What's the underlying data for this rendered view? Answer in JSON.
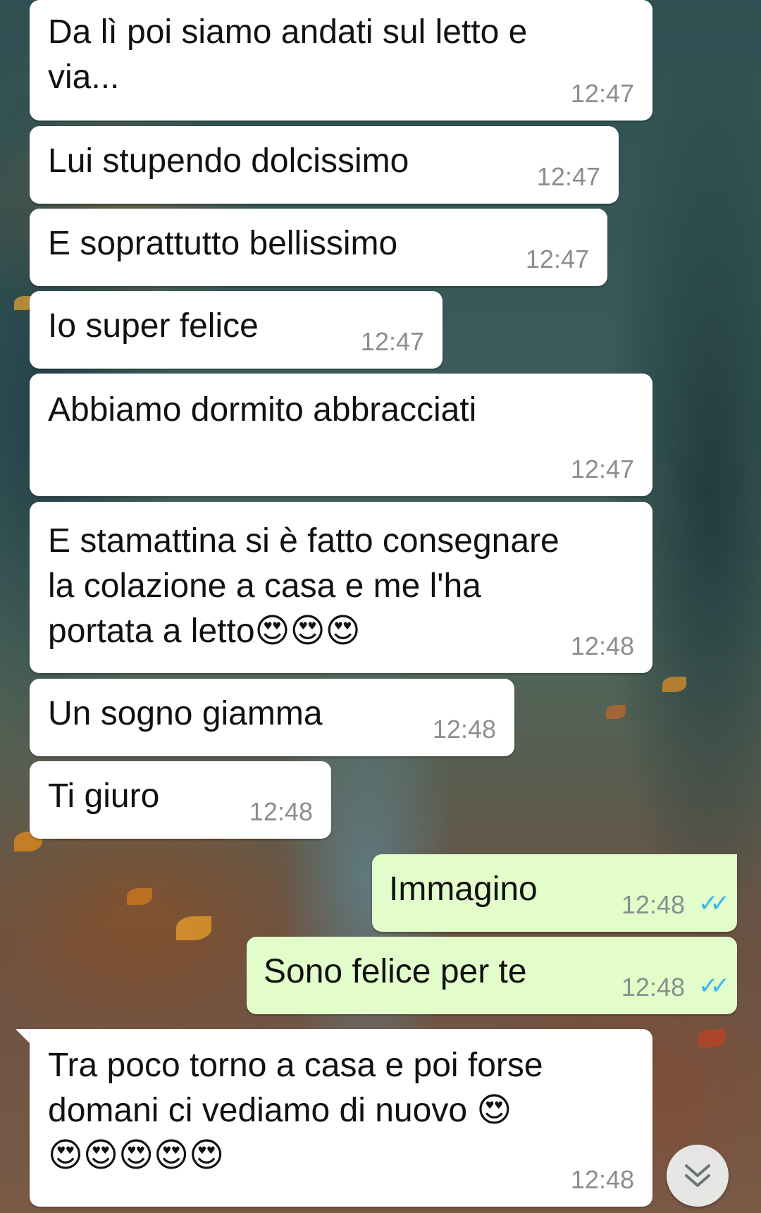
{
  "messages": [
    {
      "direction": "in",
      "text": "Da lì poi siamo andati sul letto e\nvia...",
      "time": "12:47"
    },
    {
      "direction": "in",
      "text": "Lui stupendo dolcissimo",
      "time": "12:47"
    },
    {
      "direction": "in",
      "text": "E soprattutto bellissimo",
      "time": "12:47"
    },
    {
      "direction": "in",
      "text": "Io super felice",
      "time": "12:47"
    },
    {
      "direction": "in",
      "text": "Abbiamo dormito abbracciati",
      "time": "12:47"
    },
    {
      "direction": "in",
      "text": "E stamattina si è fatto consegnare\nla colazione a casa e me l'ha\nportata a letto😍😍😍",
      "time": "12:48"
    },
    {
      "direction": "in",
      "text": "Un sogno giamma",
      "time": "12:48"
    },
    {
      "direction": "in",
      "text": "Ti giuro",
      "time": "12:48"
    },
    {
      "direction": "out",
      "text": "Immagino",
      "time": "12:48",
      "status": "read",
      "status_icon": "double-check-icon"
    },
    {
      "direction": "out",
      "text": "Sono felice per te",
      "time": "12:48",
      "status": "read",
      "status_icon": "double-check-icon"
    },
    {
      "direction": "in",
      "text": "Tra poco torno a casa e poi forse\ndomani ci vediamo di nuovo 😍\n😍😍😍😍😍",
      "time": "12:48"
    }
  ],
  "scroll_button": {
    "icon": "double-chevron-down-icon"
  },
  "colors": {
    "incoming_bubble": "#ffffff",
    "outgoing_bubble": "#e2fdca",
    "timestamp": "#8a8f8d",
    "read_ticks": "#34b7f1"
  }
}
